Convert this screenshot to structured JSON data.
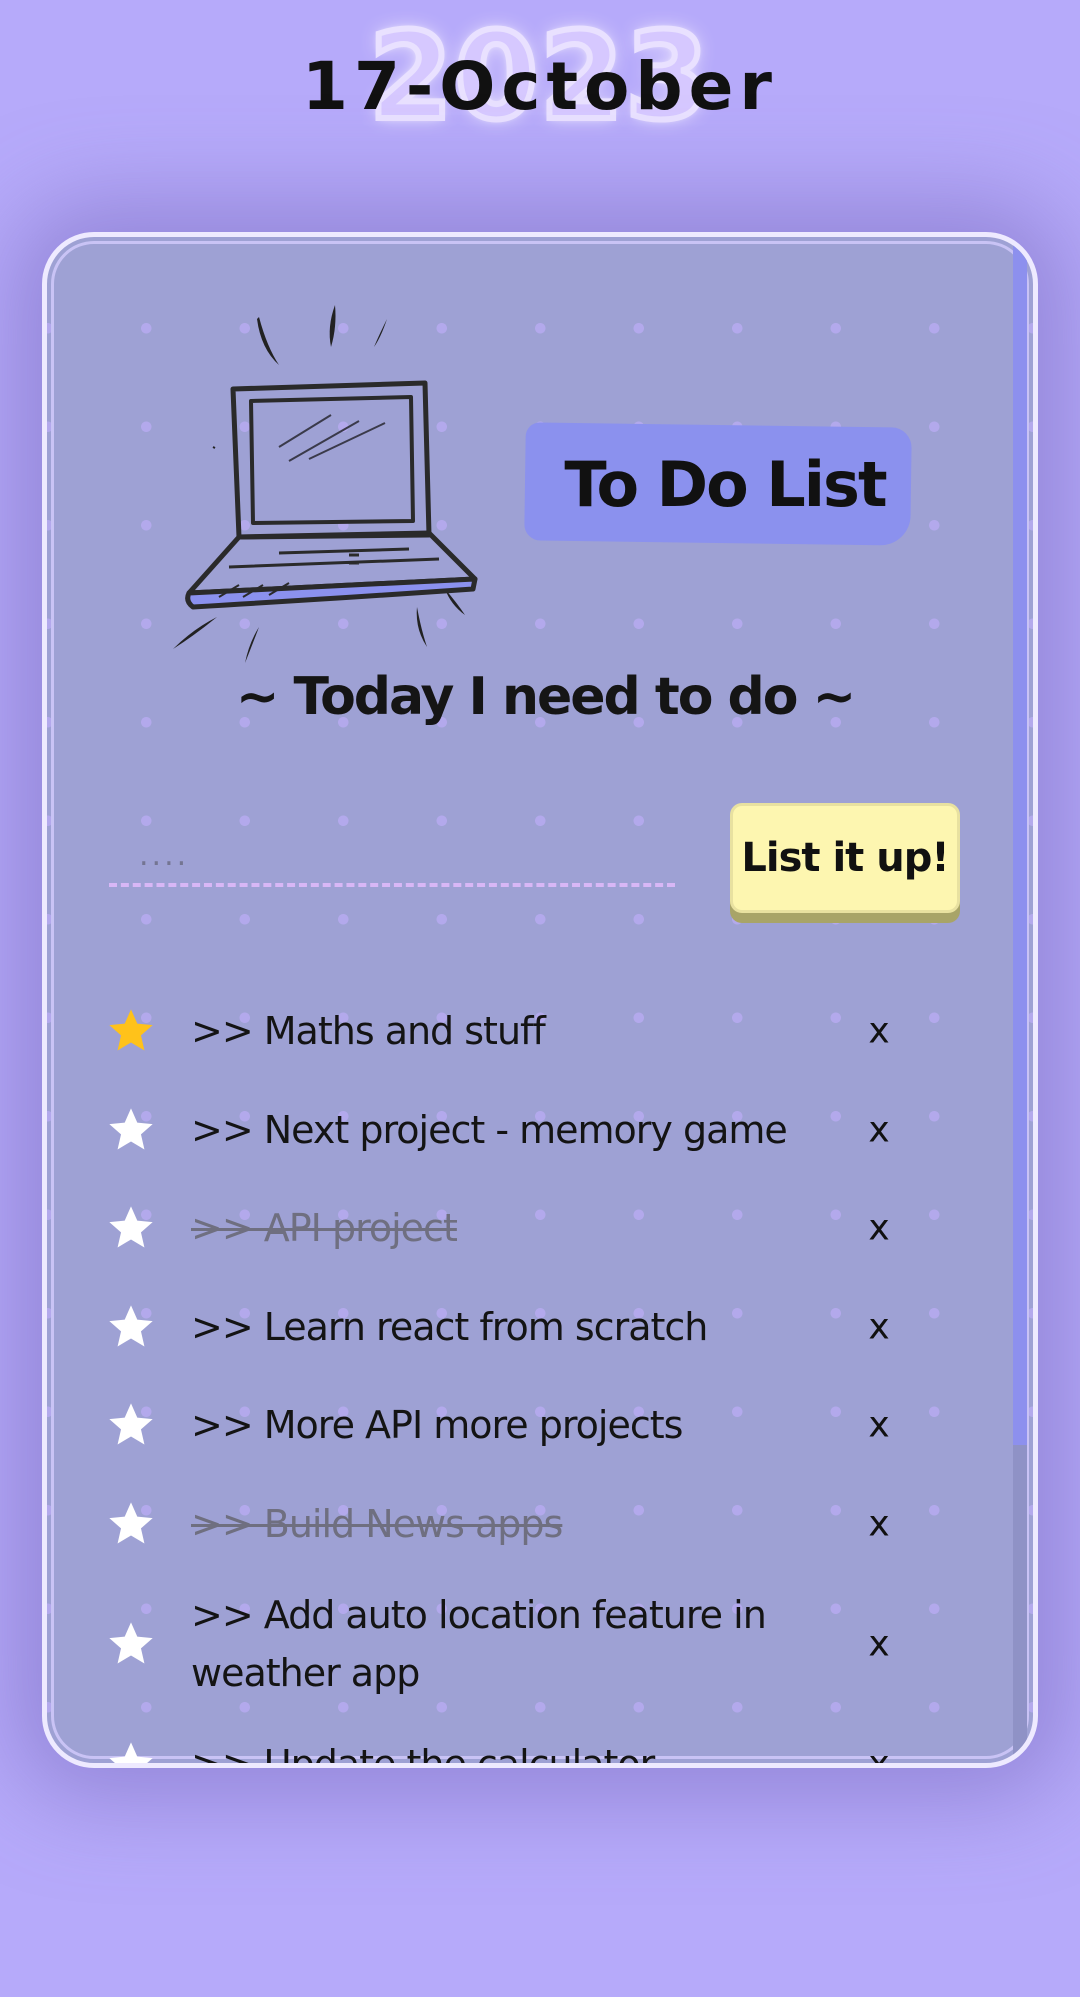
{
  "header": {
    "year": "2023",
    "date": "17-October"
  },
  "app": {
    "title": "To Do List",
    "subtitle": "~ Today I need to do ~",
    "input_placeholder": "....",
    "add_button_label": "List it up!"
  },
  "colors": {
    "background": "#b6aafa",
    "card": "#9ea1d4",
    "title_highlight": "#8b91ee",
    "button": "#fdf6b0",
    "star_active": "#ffc21a",
    "star_inactive": "#ffffff"
  },
  "tasks": [
    {
      "text": ">> Maths and stuff",
      "starred": true,
      "done": false,
      "delete_label": "x"
    },
    {
      "text": ">> Next project - memory game",
      "starred": false,
      "done": false,
      "delete_label": "x"
    },
    {
      "text": ">> API project",
      "starred": false,
      "done": true,
      "delete_label": "x"
    },
    {
      "text": ">> Learn react from scratch",
      "starred": false,
      "done": false,
      "delete_label": "x"
    },
    {
      "text": ">> More API more projects",
      "starred": false,
      "done": false,
      "delete_label": "x"
    },
    {
      "text": ">> Build News apps",
      "starred": false,
      "done": true,
      "delete_label": "x"
    },
    {
      "text": ">> Add auto location feature in weather app",
      "starred": false,
      "done": false,
      "delete_label": "x"
    },
    {
      "text": ">> Update the calculator",
      "starred": false,
      "done": false,
      "delete_label": "x"
    }
  ]
}
